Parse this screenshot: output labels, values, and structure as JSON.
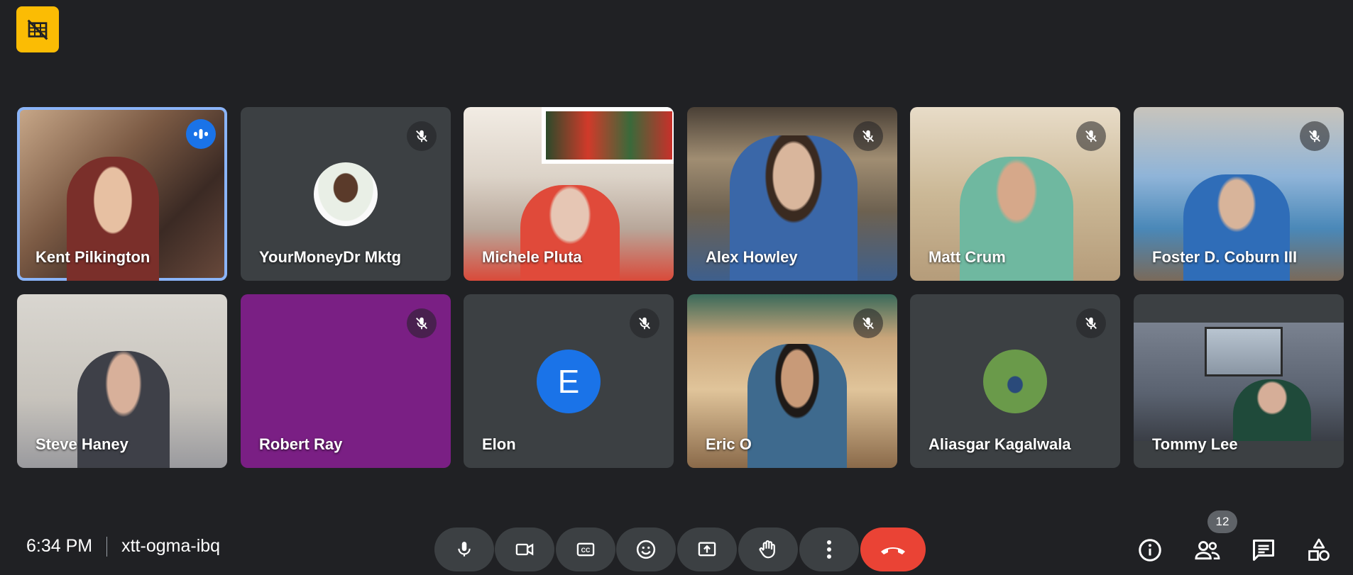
{
  "meeting": {
    "time": "6:34 PM",
    "code": "xtt-ogma-ibq",
    "participant_count": "12"
  },
  "participants": [
    {
      "name": "Kent Pilkington",
      "speaking": true,
      "muted": false
    },
    {
      "name": "YourMoneyDr Mktg",
      "muted": true
    },
    {
      "name": "Michele Pluta",
      "muted": false
    },
    {
      "name": "Alex Howley",
      "muted": true
    },
    {
      "name": "Matt Crum",
      "muted": true
    },
    {
      "name": "Foster D. Coburn III",
      "muted": true
    },
    {
      "name": "Steve Haney",
      "muted": false
    },
    {
      "name": "Robert Ray",
      "muted": true
    },
    {
      "name": "Elon",
      "muted": true,
      "initial": "E"
    },
    {
      "name": "Eric O",
      "muted": true
    },
    {
      "name": "Aliasgar Kagalwala",
      "muted": true
    },
    {
      "name": "Tommy Lee",
      "muted": false
    }
  ],
  "colors": {
    "background": "#202124",
    "tile": "#3c4043",
    "active_border": "#8ab4f8",
    "end_call": "#ea4335",
    "accent": "#1a73e8",
    "warning_badge": "#fbbc04"
  },
  "controls": [
    "mic-icon",
    "camera-icon",
    "captions-icon",
    "emoji-icon",
    "present-icon",
    "raise-hand-icon",
    "more-options-icon",
    "end-call-icon"
  ],
  "side_controls": [
    "info-icon",
    "people-icon",
    "chat-icon",
    "activities-icon"
  ]
}
